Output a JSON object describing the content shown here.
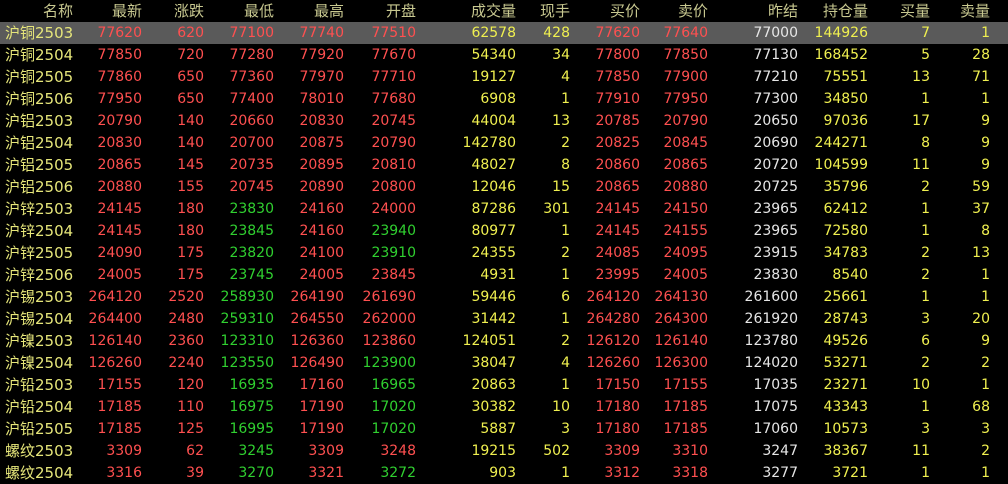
{
  "colors": {
    "background": "#000000",
    "header_text": "#c8c890",
    "name_text": "#e6e67a",
    "up": "#ff5050",
    "down": "#30d030",
    "neutral": "#e6e6e6",
    "volume": "#f0f050",
    "selected_row": "#5a5a5a"
  },
  "headers": [
    "名称",
    "最新",
    "涨跌",
    "最低",
    "最高",
    "开盘",
    "成交量",
    "现手",
    "买价",
    "卖价",
    "昨结",
    "持仓量",
    "买量",
    "卖量"
  ],
  "selected_index": 0,
  "rows": [
    {
      "name": "沪铜2503",
      "last": "77620",
      "chg": "620",
      "low": "77100",
      "high": "77740",
      "open": "77510",
      "vol": "62578",
      "cur": "428",
      "bid": "77620",
      "ask": "77640",
      "prev": "77000",
      "oi": "144926",
      "bq": "7",
      "aq": "1",
      "c_last": "up",
      "c_chg": "up",
      "c_low": "up",
      "c_high": "up",
      "c_open": "up",
      "c_bid": "up",
      "c_ask": "up"
    },
    {
      "name": "沪铜2504",
      "last": "77850",
      "chg": "720",
      "low": "77280",
      "high": "77920",
      "open": "77670",
      "vol": "54340",
      "cur": "34",
      "bid": "77800",
      "ask": "77850",
      "prev": "77130",
      "oi": "168452",
      "bq": "5",
      "aq": "28",
      "c_last": "up",
      "c_chg": "up",
      "c_low": "up",
      "c_high": "up",
      "c_open": "up",
      "c_bid": "up",
      "c_ask": "up"
    },
    {
      "name": "沪铜2505",
      "last": "77860",
      "chg": "650",
      "low": "77360",
      "high": "77970",
      "open": "77710",
      "vol": "19127",
      "cur": "4",
      "bid": "77850",
      "ask": "77900",
      "prev": "77210",
      "oi": "75551",
      "bq": "13",
      "aq": "71",
      "c_last": "up",
      "c_chg": "up",
      "c_low": "up",
      "c_high": "up",
      "c_open": "up",
      "c_bid": "up",
      "c_ask": "up"
    },
    {
      "name": "沪铜2506",
      "last": "77950",
      "chg": "650",
      "low": "77400",
      "high": "78010",
      "open": "77680",
      "vol": "6908",
      "cur": "1",
      "bid": "77910",
      "ask": "77950",
      "prev": "77300",
      "oi": "34850",
      "bq": "1",
      "aq": "1",
      "c_last": "up",
      "c_chg": "up",
      "c_low": "up",
      "c_high": "up",
      "c_open": "up",
      "c_bid": "up",
      "c_ask": "up"
    },
    {
      "name": "沪铝2503",
      "last": "20790",
      "chg": "140",
      "low": "20660",
      "high": "20830",
      "open": "20745",
      "vol": "44004",
      "cur": "13",
      "bid": "20785",
      "ask": "20790",
      "prev": "20650",
      "oi": "97036",
      "bq": "17",
      "aq": "9",
      "c_last": "up",
      "c_chg": "up",
      "c_low": "up",
      "c_high": "up",
      "c_open": "up",
      "c_bid": "up",
      "c_ask": "up"
    },
    {
      "name": "沪铝2504",
      "last": "20830",
      "chg": "140",
      "low": "20700",
      "high": "20875",
      "open": "20790",
      "vol": "142780",
      "cur": "2",
      "bid": "20825",
      "ask": "20845",
      "prev": "20690",
      "oi": "244271",
      "bq": "8",
      "aq": "9",
      "c_last": "up",
      "c_chg": "up",
      "c_low": "up",
      "c_high": "up",
      "c_open": "up",
      "c_bid": "up",
      "c_ask": "up"
    },
    {
      "name": "沪铝2505",
      "last": "20865",
      "chg": "145",
      "low": "20735",
      "high": "20895",
      "open": "20810",
      "vol": "48027",
      "cur": "8",
      "bid": "20860",
      "ask": "20865",
      "prev": "20720",
      "oi": "104599",
      "bq": "11",
      "aq": "9",
      "c_last": "up",
      "c_chg": "up",
      "c_low": "up",
      "c_high": "up",
      "c_open": "up",
      "c_bid": "up",
      "c_ask": "up"
    },
    {
      "name": "沪铝2506",
      "last": "20880",
      "chg": "155",
      "low": "20745",
      "high": "20890",
      "open": "20800",
      "vol": "12046",
      "cur": "15",
      "bid": "20865",
      "ask": "20880",
      "prev": "20725",
      "oi": "35796",
      "bq": "2",
      "aq": "59",
      "c_last": "up",
      "c_chg": "up",
      "c_low": "up",
      "c_high": "up",
      "c_open": "up",
      "c_bid": "up",
      "c_ask": "up"
    },
    {
      "name": "沪锌2503",
      "last": "24145",
      "chg": "180",
      "low": "23830",
      "high": "24160",
      "open": "24000",
      "vol": "87286",
      "cur": "301",
      "bid": "24145",
      "ask": "24150",
      "prev": "23965",
      "oi": "62412",
      "bq": "1",
      "aq": "37",
      "c_last": "up",
      "c_chg": "up",
      "c_low": "down",
      "c_high": "up",
      "c_open": "up",
      "c_bid": "up",
      "c_ask": "up"
    },
    {
      "name": "沪锌2504",
      "last": "24145",
      "chg": "180",
      "low": "23845",
      "high": "24160",
      "open": "23940",
      "vol": "80977",
      "cur": "1",
      "bid": "24145",
      "ask": "24155",
      "prev": "23965",
      "oi": "72580",
      "bq": "1",
      "aq": "8",
      "c_last": "up",
      "c_chg": "up",
      "c_low": "down",
      "c_high": "up",
      "c_open": "down",
      "c_bid": "up",
      "c_ask": "up"
    },
    {
      "name": "沪锌2505",
      "last": "24090",
      "chg": "175",
      "low": "23820",
      "high": "24100",
      "open": "23910",
      "vol": "24355",
      "cur": "2",
      "bid": "24085",
      "ask": "24095",
      "prev": "23915",
      "oi": "34783",
      "bq": "2",
      "aq": "13",
      "c_last": "up",
      "c_chg": "up",
      "c_low": "down",
      "c_high": "up",
      "c_open": "down",
      "c_bid": "up",
      "c_ask": "up"
    },
    {
      "name": "沪锌2506",
      "last": "24005",
      "chg": "175",
      "low": "23745",
      "high": "24005",
      "open": "23845",
      "vol": "4931",
      "cur": "1",
      "bid": "23995",
      "ask": "24005",
      "prev": "23830",
      "oi": "8540",
      "bq": "2",
      "aq": "1",
      "c_last": "up",
      "c_chg": "up",
      "c_low": "down",
      "c_high": "up",
      "c_open": "up",
      "c_bid": "up",
      "c_ask": "up"
    },
    {
      "name": "沪锡2503",
      "last": "264120",
      "chg": "2520",
      "low": "258930",
      "high": "264190",
      "open": "261690",
      "vol": "59446",
      "cur": "6",
      "bid": "264120",
      "ask": "264130",
      "prev": "261600",
      "oi": "25661",
      "bq": "1",
      "aq": "1",
      "c_last": "up",
      "c_chg": "up",
      "c_low": "down",
      "c_high": "up",
      "c_open": "up",
      "c_bid": "up",
      "c_ask": "up"
    },
    {
      "name": "沪锡2504",
      "last": "264400",
      "chg": "2480",
      "low": "259310",
      "high": "264550",
      "open": "262000",
      "vol": "31442",
      "cur": "1",
      "bid": "264280",
      "ask": "264300",
      "prev": "261920",
      "oi": "28743",
      "bq": "3",
      "aq": "20",
      "c_last": "up",
      "c_chg": "up",
      "c_low": "down",
      "c_high": "up",
      "c_open": "up",
      "c_bid": "up",
      "c_ask": "up"
    },
    {
      "name": "沪镍2503",
      "last": "126140",
      "chg": "2360",
      "low": "123310",
      "high": "126360",
      "open": "123860",
      "vol": "124051",
      "cur": "2",
      "bid": "126120",
      "ask": "126140",
      "prev": "123780",
      "oi": "49526",
      "bq": "6",
      "aq": "9",
      "c_last": "up",
      "c_chg": "up",
      "c_low": "down",
      "c_high": "up",
      "c_open": "up",
      "c_bid": "up",
      "c_ask": "up"
    },
    {
      "name": "沪镍2504",
      "last": "126260",
      "chg": "2240",
      "low": "123550",
      "high": "126490",
      "open": "123900",
      "vol": "38047",
      "cur": "4",
      "bid": "126260",
      "ask": "126300",
      "prev": "124020",
      "oi": "53271",
      "bq": "2",
      "aq": "2",
      "c_last": "up",
      "c_chg": "up",
      "c_low": "down",
      "c_high": "up",
      "c_open": "down",
      "c_bid": "up",
      "c_ask": "up"
    },
    {
      "name": "沪铅2503",
      "last": "17155",
      "chg": "120",
      "low": "16935",
      "high": "17160",
      "open": "16965",
      "vol": "20863",
      "cur": "1",
      "bid": "17150",
      "ask": "17155",
      "prev": "17035",
      "oi": "23271",
      "bq": "10",
      "aq": "1",
      "c_last": "up",
      "c_chg": "up",
      "c_low": "down",
      "c_high": "up",
      "c_open": "down",
      "c_bid": "up",
      "c_ask": "up"
    },
    {
      "name": "沪铅2504",
      "last": "17185",
      "chg": "110",
      "low": "16975",
      "high": "17190",
      "open": "17020",
      "vol": "30382",
      "cur": "10",
      "bid": "17180",
      "ask": "17185",
      "prev": "17075",
      "oi": "43343",
      "bq": "1",
      "aq": "68",
      "c_last": "up",
      "c_chg": "up",
      "c_low": "down",
      "c_high": "up",
      "c_open": "down",
      "c_bid": "up",
      "c_ask": "up"
    },
    {
      "name": "沪铅2505",
      "last": "17185",
      "chg": "125",
      "low": "16995",
      "high": "17190",
      "open": "17020",
      "vol": "5887",
      "cur": "3",
      "bid": "17180",
      "ask": "17185",
      "prev": "17060",
      "oi": "10573",
      "bq": "3",
      "aq": "3",
      "c_last": "up",
      "c_chg": "up",
      "c_low": "down",
      "c_high": "up",
      "c_open": "down",
      "c_bid": "up",
      "c_ask": "up"
    },
    {
      "name": "螺纹2503",
      "last": "3309",
      "chg": "62",
      "low": "3245",
      "high": "3309",
      "open": "3248",
      "vol": "19215",
      "cur": "502",
      "bid": "3309",
      "ask": "3310",
      "prev": "3247",
      "oi": "38367",
      "bq": "11",
      "aq": "2",
      "c_last": "up",
      "c_chg": "up",
      "c_low": "down",
      "c_high": "up",
      "c_open": "up",
      "c_bid": "up",
      "c_ask": "up"
    },
    {
      "name": "螺纹2504",
      "last": "3316",
      "chg": "39",
      "low": "3270",
      "high": "3321",
      "open": "3272",
      "vol": "903",
      "cur": "1",
      "bid": "3312",
      "ask": "3318",
      "prev": "3277",
      "oi": "3721",
      "bq": "1",
      "aq": "1",
      "c_last": "up",
      "c_chg": "up",
      "c_low": "down",
      "c_high": "up",
      "c_open": "down",
      "c_bid": "up",
      "c_ask": "up"
    }
  ]
}
